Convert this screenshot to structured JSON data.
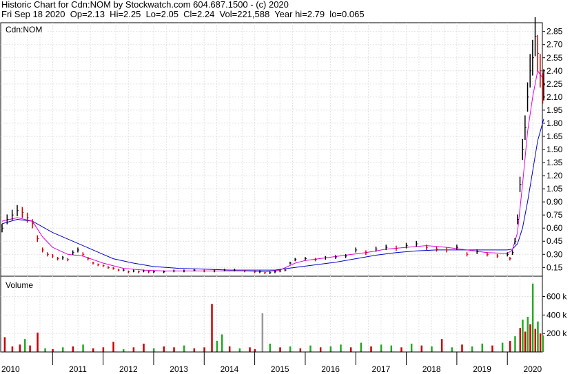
{
  "header": {
    "line1": "Historic Chart for Cdn:NOM by Stockwatch.com 604.687.1500 - (c) 2020",
    "line2": "Fri Sep 18 2020  Op=2.13  Hi=2.25  Lo=2.05  Cl=2.24  Vol=221,588  Year hi=2.79  lo=0.065"
  },
  "chart_data": [
    {
      "type": "line",
      "title": "Cdn:NOM",
      "x_ticks": [
        "2010",
        "2011",
        "2012",
        "2013",
        "2014",
        "2015",
        "2016",
        "2017",
        "2018",
        "2019",
        "2020"
      ],
      "y_ticks": [
        "2.85",
        "2.70",
        "2.55",
        "2.40",
        "2.25",
        "2.10",
        "1.95",
        "1.80",
        "1.65",
        "1.50",
        "1.35",
        "1.20",
        "1.05",
        "0.90",
        "0.75",
        "0.60",
        "0.45",
        "0.30",
        "0.15"
      ],
      "ylim": [
        0.05,
        2.95
      ],
      "grid": true,
      "series_colors": {
        "price_up": "#000000",
        "price_down": "#cc0000",
        "ma_short": "#e000e0",
        "ma_long": "#0000cc"
      },
      "price_close": {
        "x": [
          2010.0,
          2010.1,
          2010.2,
          2010.3,
          2010.4,
          2010.5,
          2010.6,
          2010.7,
          2010.8,
          2010.9,
          2011.0,
          2011.1,
          2011.2,
          2011.3,
          2011.4,
          2011.5,
          2011.6,
          2011.7,
          2011.8,
          2011.9,
          2012.0,
          2012.1,
          2012.2,
          2012.3,
          2012.4,
          2012.5,
          2012.6,
          2012.7,
          2012.8,
          2012.9,
          2013.0,
          2013.2,
          2013.4,
          2013.6,
          2013.8,
          2014.0,
          2014.2,
          2014.4,
          2014.6,
          2014.8,
          2015.0,
          2015.1,
          2015.2,
          2015.3,
          2015.4,
          2015.5,
          2015.6,
          2015.7,
          2015.8,
          2016.0,
          2016.2,
          2016.4,
          2016.6,
          2016.8,
          2017.0,
          2017.2,
          2017.4,
          2017.6,
          2017.8,
          2018.0,
          2018.2,
          2018.4,
          2018.6,
          2018.8,
          2019.0,
          2019.2,
          2019.4,
          2019.6,
          2019.8,
          2020.0,
          2020.05,
          2020.1,
          2020.15,
          2020.2,
          2020.25,
          2020.3,
          2020.35,
          2020.4,
          2020.45,
          2020.5,
          2020.55,
          2020.6,
          2020.65,
          2020.7,
          2020.72
        ],
        "y": [
          0.6,
          0.7,
          0.75,
          0.8,
          0.78,
          0.72,
          0.65,
          0.48,
          0.35,
          0.3,
          0.28,
          0.25,
          0.26,
          0.24,
          0.32,
          0.35,
          0.3,
          0.25,
          0.2,
          0.18,
          0.17,
          0.15,
          0.14,
          0.12,
          0.12,
          0.1,
          0.11,
          0.1,
          0.11,
          0.1,
          0.1,
          0.1,
          0.11,
          0.11,
          0.12,
          0.11,
          0.11,
          0.12,
          0.12,
          0.11,
          0.1,
          0.1,
          0.09,
          0.09,
          0.1,
          0.11,
          0.12,
          0.2,
          0.24,
          0.25,
          0.24,
          0.26,
          0.27,
          0.28,
          0.35,
          0.32,
          0.36,
          0.38,
          0.37,
          0.4,
          0.42,
          0.38,
          0.36,
          0.35,
          0.38,
          0.3,
          0.33,
          0.3,
          0.28,
          0.3,
          0.25,
          0.32,
          0.45,
          0.7,
          1.1,
          1.5,
          1.75,
          2.1,
          2.4,
          2.55,
          2.79,
          2.6,
          2.4,
          2.2,
          2.24
        ]
      },
      "ma_short": {
        "x": [
          2010.0,
          2010.3,
          2010.6,
          2010.8,
          2011.0,
          2011.3,
          2011.6,
          2012.0,
          2012.4,
          2012.8,
          2013.2,
          2013.6,
          2014.0,
          2014.4,
          2014.8,
          2015.2,
          2015.5,
          2015.8,
          2016.0,
          2016.4,
          2016.8,
          2017.2,
          2017.6,
          2018.0,
          2018.4,
          2018.8,
          2019.2,
          2019.6,
          2020.0,
          2020.1,
          2020.2,
          2020.3,
          2020.4,
          2020.5,
          2020.6,
          2020.72
        ],
        "y": [
          0.68,
          0.72,
          0.68,
          0.5,
          0.38,
          0.3,
          0.28,
          0.2,
          0.14,
          0.12,
          0.11,
          0.11,
          0.11,
          0.11,
          0.11,
          0.1,
          0.12,
          0.2,
          0.23,
          0.26,
          0.29,
          0.32,
          0.36,
          0.38,
          0.4,
          0.38,
          0.35,
          0.32,
          0.31,
          0.35,
          0.55,
          1.1,
          1.7,
          2.1,
          2.4,
          2.3
        ]
      },
      "ma_long": {
        "x": [
          2010.0,
          2010.3,
          2010.6,
          2011.0,
          2011.4,
          2011.8,
          2012.2,
          2012.6,
          2013.0,
          2013.5,
          2014.0,
          2014.5,
          2015.0,
          2015.4,
          2015.8,
          2016.2,
          2016.6,
          2017.0,
          2017.4,
          2017.8,
          2018.2,
          2018.6,
          2019.0,
          2019.4,
          2019.8,
          2020.0,
          2020.1,
          2020.2,
          2020.3,
          2020.4,
          2020.5,
          2020.6,
          2020.72
        ],
        "y": [
          0.65,
          0.7,
          0.68,
          0.55,
          0.45,
          0.35,
          0.25,
          0.2,
          0.16,
          0.14,
          0.13,
          0.12,
          0.12,
          0.12,
          0.15,
          0.18,
          0.21,
          0.25,
          0.29,
          0.32,
          0.34,
          0.35,
          0.35,
          0.35,
          0.35,
          0.35,
          0.36,
          0.42,
          0.6,
          0.9,
          1.25,
          1.6,
          1.85
        ]
      }
    },
    {
      "type": "bar",
      "title": "Volume",
      "y_ticks": [
        "600 k",
        "400 k",
        "200 k"
      ],
      "ylim": [
        0,
        820000
      ],
      "grid": true,
      "colors": {
        "down": "#cc0000",
        "up": "#22aa22",
        "flat": "#999999"
      },
      "bars": {
        "x": [
          2010.05,
          2010.2,
          2010.35,
          2010.45,
          2010.55,
          2010.7,
          2010.85,
          2011.0,
          2011.2,
          2011.4,
          2011.6,
          2011.8,
          2012.0,
          2012.2,
          2012.4,
          2012.6,
          2012.8,
          2013.0,
          2013.2,
          2013.4,
          2013.6,
          2013.8,
          2014.0,
          2014.15,
          2014.25,
          2014.35,
          2014.5,
          2014.7,
          2014.9,
          2015.0,
          2015.15,
          2015.3,
          2015.5,
          2015.7,
          2015.9,
          2016.1,
          2016.3,
          2016.5,
          2016.7,
          2016.9,
          2017.1,
          2017.3,
          2017.5,
          2017.7,
          2017.9,
          2018.1,
          2018.3,
          2018.5,
          2018.7,
          2018.9,
          2019.1,
          2019.3,
          2019.5,
          2019.7,
          2019.9,
          2020.05,
          2020.15,
          2020.25,
          2020.3,
          2020.35,
          2020.4,
          2020.45,
          2020.5,
          2020.55,
          2020.6,
          2020.65,
          2020.7
        ],
        "v": [
          160000,
          60000,
          80000,
          140000,
          70000,
          210000,
          40000,
          30000,
          50000,
          60000,
          80000,
          40000,
          50000,
          110000,
          30000,
          50000,
          90000,
          40000,
          60000,
          50000,
          70000,
          40000,
          50000,
          520000,
          120000,
          190000,
          60000,
          40000,
          50000,
          30000,
          420000,
          90000,
          50000,
          60000,
          40000,
          70000,
          50000,
          60000,
          80000,
          50000,
          100000,
          60000,
          80000,
          70000,
          50000,
          90000,
          70000,
          60000,
          140000,
          50000,
          80000,
          60000,
          90000,
          70000,
          100000,
          120000,
          170000,
          260000,
          350000,
          220000,
          380000,
          300000,
          740000,
          250000,
          330000,
          200000,
          180000
        ],
        "dir": [
          "down",
          "down",
          "down",
          "up",
          "down",
          "down",
          "up",
          "down",
          "up",
          "down",
          "up",
          "down",
          "down",
          "down",
          "up",
          "down",
          "down",
          "up",
          "down",
          "down",
          "up",
          "down",
          "down",
          "down",
          "up",
          "up",
          "down",
          "up",
          "down",
          "down",
          "flat",
          "up",
          "down",
          "up",
          "down",
          "up",
          "down",
          "up",
          "up",
          "down",
          "up",
          "down",
          "up",
          "up",
          "down",
          "up",
          "down",
          "up",
          "down",
          "up",
          "down",
          "up",
          "up",
          "down",
          "up",
          "down",
          "up",
          "down",
          "up",
          "down",
          "up",
          "down",
          "up",
          "down",
          "up",
          "down",
          "up"
        ]
      }
    }
  ]
}
